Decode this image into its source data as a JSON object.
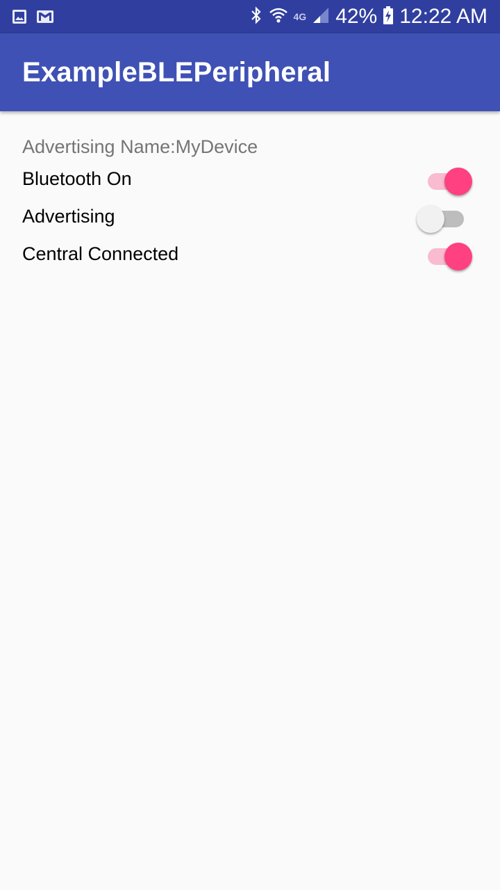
{
  "status_bar": {
    "battery": "42%",
    "time": "12:22 AM",
    "network": "4G",
    "icons": [
      "image-icon",
      "gmail-icon",
      "bluetooth-icon",
      "wifi-icon",
      "signal-icon",
      "battery-charging-icon"
    ]
  },
  "app_bar": {
    "title": "ExampleBLEPeripheral"
  },
  "main": {
    "advertising_name": "Advertising Name:MyDevice",
    "rows": [
      {
        "label": "Bluetooth On",
        "checked": true
      },
      {
        "label": "Advertising",
        "checked": false
      },
      {
        "label": "Central Connected",
        "checked": true
      }
    ]
  },
  "colors": {
    "status_bar": "#303f9f",
    "app_bar": "#3f51b5",
    "accent": "#ff4081",
    "accent_track": "#f8bbd0",
    "switch_off_thumb": "#f1f1f1",
    "switch_off_track": "#bdbdbd",
    "background": "#fafafa"
  }
}
